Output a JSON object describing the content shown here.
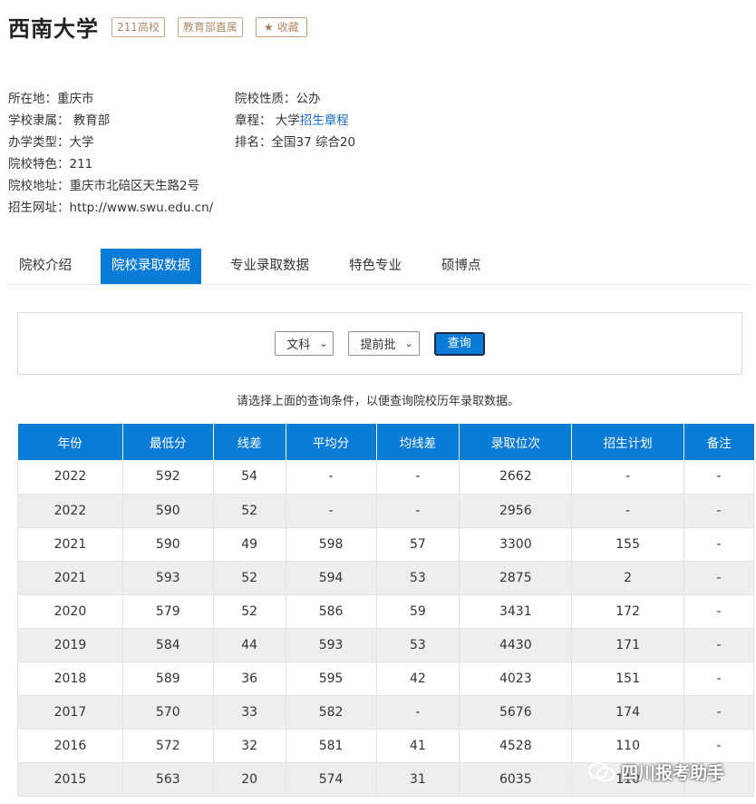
{
  "university": {
    "name": "西南大学",
    "tags": [
      "211高校",
      "教育部直属"
    ],
    "favorite_label": "收藏"
  },
  "info_left": [
    {
      "label": "所在地：",
      "value": "重庆市"
    },
    {
      "label": "学校隶属：",
      "value": " 教育部"
    },
    {
      "label": "办学类型：",
      "value": "大学"
    },
    {
      "label": "院校特色：",
      "value": "211"
    },
    {
      "label": "院校地址：",
      "value": "重庆市北碚区天生路2号"
    },
    {
      "label": "招生网址：",
      "value": "http://www.swu.edu.cn/"
    }
  ],
  "info_right": {
    "nature": {
      "label": "院校性质：",
      "value": "公办"
    },
    "charter": {
      "label": "章程：",
      "prefix": " 大学",
      "link": "招生章程"
    },
    "rank": {
      "label": "排名：",
      "value": "全国37 综合20"
    }
  },
  "tabs": [
    "院校介绍",
    "院校录取数据",
    "专业录取数据",
    "特色专业",
    "硕博点"
  ],
  "active_tab": 1,
  "query": {
    "subject": "文科",
    "batch": "提前批",
    "button": "查询"
  },
  "hint": "请选择上面的查询条件，以便查询院校历年录取数据。",
  "table": {
    "headers": [
      "年份",
      "最低分",
      "线差",
      "平均分",
      "均线差",
      "录取位次",
      "招生计划",
      "备注"
    ],
    "rows": [
      [
        "2022",
        "592",
        "54",
        "-",
        "-",
        "2662",
        "-",
        "-"
      ],
      [
        "2022",
        "590",
        "52",
        "-",
        "-",
        "2956",
        "-",
        "-"
      ],
      [
        "2021",
        "590",
        "49",
        "598",
        "57",
        "3300",
        "155",
        "-"
      ],
      [
        "2021",
        "593",
        "52",
        "594",
        "53",
        "2875",
        "2",
        "-"
      ],
      [
        "2020",
        "579",
        "52",
        "586",
        "59",
        "3431",
        "172",
        "-"
      ],
      [
        "2019",
        "584",
        "44",
        "593",
        "53",
        "4430",
        "171",
        "-"
      ],
      [
        "2018",
        "589",
        "36",
        "595",
        "42",
        "4023",
        "151",
        "-"
      ],
      [
        "2017",
        "570",
        "33",
        "582",
        "-",
        "5676",
        "174",
        "-"
      ],
      [
        "2016",
        "572",
        "32",
        "581",
        "41",
        "4528",
        "110",
        "-"
      ],
      [
        "2015",
        "563",
        "20",
        "574",
        "31",
        "6035",
        "110",
        "-"
      ]
    ]
  },
  "watermark": "四川报考助手",
  "colors": {
    "accent": "#0b7bd8",
    "tag_border": "#c9a98a",
    "link": "#1a6ccc"
  }
}
